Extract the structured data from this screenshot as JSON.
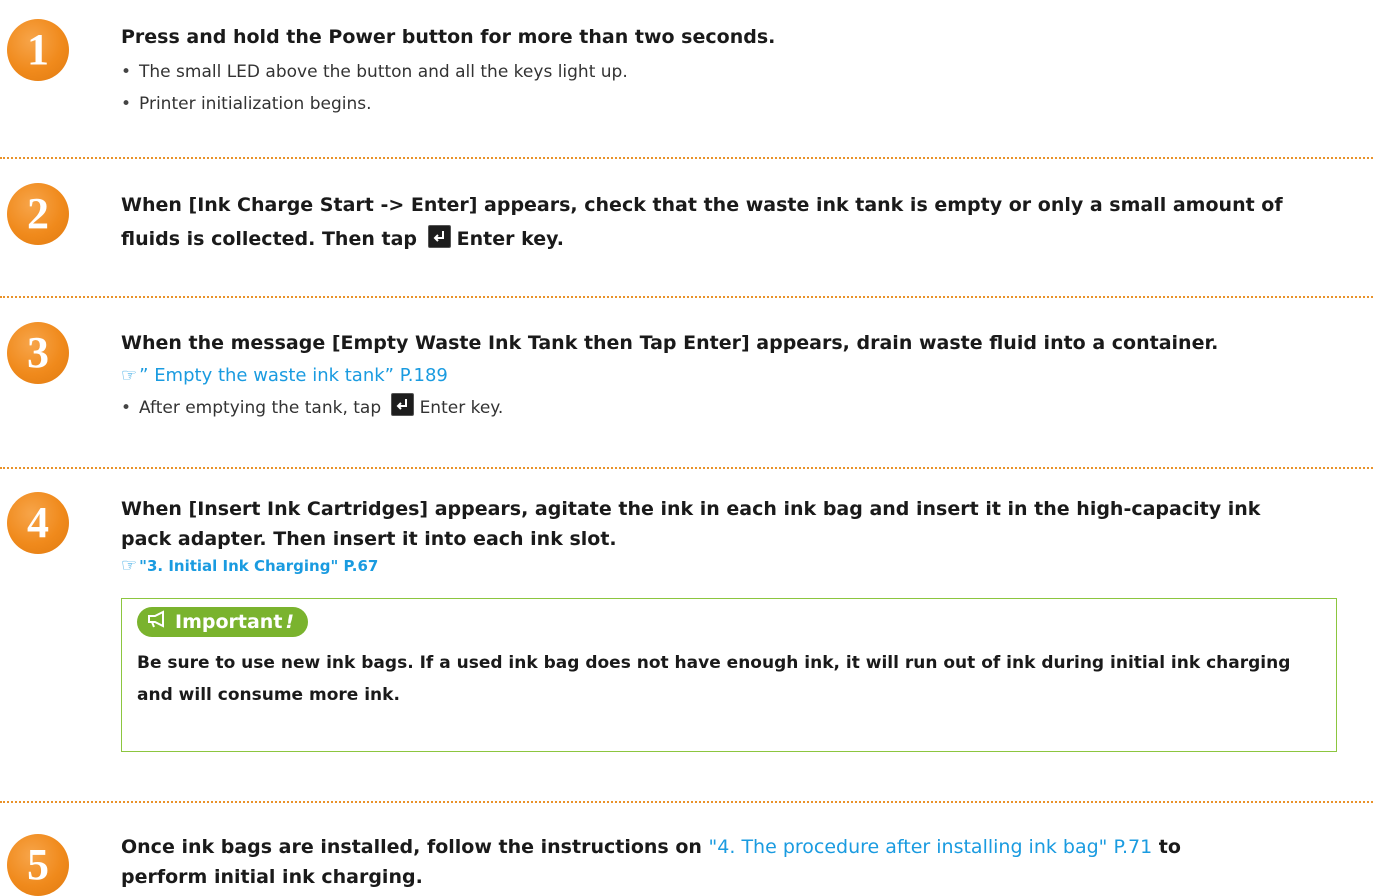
{
  "colors": {
    "accent_orange": "#F08A1C",
    "link_blue": "#1A9BE0",
    "important_green": "#7AB32E",
    "divider": "#E9922A"
  },
  "icons": {
    "enter_key": "enter-key-icon",
    "reference": "pointing-hand-icon",
    "important": "megaphone-icon"
  },
  "steps": [
    {
      "number": "1",
      "heading": "Press and hold the Power button for more than two seconds.",
      "bullets": [
        "The small LED above the button and all the keys light up.",
        "Printer initialization begins."
      ]
    },
    {
      "number": "2",
      "heading_line1": "When [Ink Charge  Start  -> Enter] appears, check that the waste ink tank is empty or only a small amount of",
      "heading_line2_a": "fluids is collected. Then tap",
      "heading_line2_b": "Enter key."
    },
    {
      "number": "3",
      "heading": "When the message [Empty Waste Ink Tank then Tap Enter] appears, drain waste fluid into a container.",
      "reference": "” Empty the waste ink tank” P.189",
      "bullet_a": "After emptying the tank, tap",
      "bullet_b": "Enter key."
    },
    {
      "number": "4",
      "heading_line1": "When [Insert Ink Cartridges] appears, agitate the ink in each ink bag and insert it in the high-capacity ink",
      "heading_line2": "pack adapter. Then insert it into each ink slot.",
      "reference": "\"3. Initial Ink Charging\" P.67",
      "important_label": "Important",
      "important_bang": "!",
      "important_text": "Be sure to use new ink bags. If a used ink bag does not have enough ink, it will run out of ink during initial ink charging and will consume more ink."
    },
    {
      "number": "5",
      "heading_a": "Once ink bags are installed, follow the instructions on",
      "heading_link": "\"4. The procedure after installing ink bag\" P.71",
      "heading_b": "to",
      "heading_line2": "perform initial ink charging."
    }
  ]
}
